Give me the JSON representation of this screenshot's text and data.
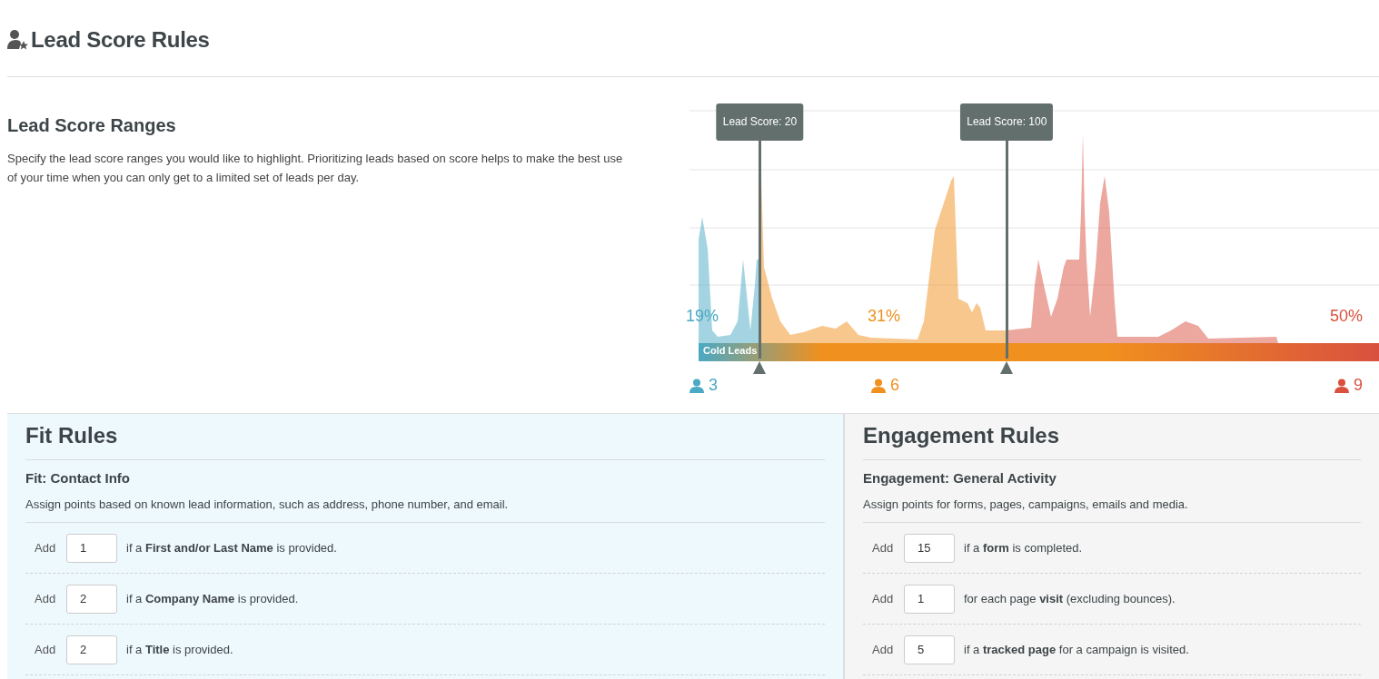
{
  "page": {
    "title": "Lead Score Rules"
  },
  "ranges": {
    "title": "Lead Score Ranges",
    "description": "Specify the lead score ranges you would like to highlight. Prioritizing leads based on score helps to make the best use of your time when you can only get to a limited set of leads per day.",
    "markers": [
      {
        "label": "Lead Score: 20",
        "level": 0.09
      },
      {
        "label": "Lead Score: 100",
        "level": 0.453
      }
    ],
    "segments": [
      {
        "label": "Cold Leads",
        "percent": "19%",
        "count": "3",
        "color": "#4aa9c4"
      },
      {
        "percent": "31%",
        "count": "6",
        "color": "#f0901e"
      },
      {
        "percent": "50%",
        "count": "9",
        "color": "#d9503f"
      }
    ]
  },
  "panels": [
    {
      "kind": "fit",
      "title": "Fit Rules",
      "subtitle": "Fit: Contact Info",
      "description": "Assign points based on known lead information, such as address, phone number, and email.",
      "rules": [
        {
          "prefix": "Add",
          "value": "1",
          "text": "if a **First and/or Last Name** is provided."
        },
        {
          "prefix": "Add",
          "value": "2",
          "text": "if a **Company Name** is provided."
        },
        {
          "prefix": "Add",
          "value": "2",
          "text": "if a **Title** is provided."
        }
      ]
    },
    {
      "kind": "engagement",
      "title": "Engagement Rules",
      "subtitle": "Engagement: General Activity",
      "description": "Assign points for forms, pages, campaigns, emails and media.",
      "rules": [
        {
          "prefix": "Add",
          "value": "15",
          "text": "if a **form** is completed."
        },
        {
          "prefix": "Add",
          "value": "1",
          "text": "for each page **visit** (excluding bounces)."
        },
        {
          "prefix": "Add",
          "value": "5",
          "text": "if a **tracked page** for a campaign is visited."
        }
      ]
    }
  ]
}
